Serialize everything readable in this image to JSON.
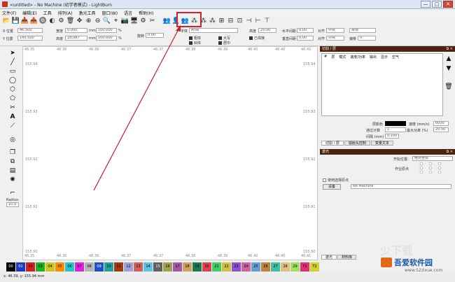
{
  "window": {
    "title": "<untitled> - No Machine (初学者模式) - LightBurn",
    "controls": [
      "—",
      "□",
      "✕"
    ]
  },
  "menu": [
    "文件(F)",
    "编辑(E)",
    "工具",
    "排列(A)",
    "激光工具",
    "窗口(W)",
    "语言",
    "帮助(H)"
  ],
  "toolbar": {
    "icons": [
      "📂",
      "💾",
      "📥",
      "📤",
      "🔘",
      "◐",
      "⚙",
      "🗑",
      "✥",
      "⊕",
      "⊖",
      "🔍",
      "⌖",
      "📷",
      "🖥",
      "⚙",
      "✂",
      "👥",
      "👤",
      "👥",
      "⁂",
      "⁂",
      "⁂",
      "⊞",
      "⊟",
      "⊡",
      "⊣",
      "⊢",
      "⊤"
    ]
  },
  "props": {
    "x_label": "X 位置",
    "x_value": "46.500",
    "y_label": "Y 位置",
    "y_value": "145.500",
    "w_label": "宽度",
    "w_value": "0.000",
    "h_label": "高度",
    "h_value": "18.087",
    "sx_value": "100.000",
    "sy_value": "100.000",
    "unit": "mm",
    "pct": "%",
    "rot_label": "旋转",
    "rot_value": "0.00",
    "font_label": "字体",
    "font_value": "Arial",
    "height_label": "高度",
    "height_value": "25.00",
    "hspace_label": "水平间距",
    "hspace_value": "0.00",
    "vspace_label": "垂直间距",
    "vspace_value": "0.00",
    "align_x_label": "对齐 X",
    "align_x_value": "中央",
    "align_y_label": "对齐 Y",
    "align_y_value": "中央",
    "normal_label": "常规",
    "offset_label": "偏移",
    "offset_value": "0",
    "bold": "粗体",
    "italic": "斜体",
    "caps": "大写",
    "welded": "已焊接",
    "weld_center": "居中"
  },
  "ruler_top": [
    "46.35",
    "46.36",
    "46.36",
    "46.37",
    "46.37",
    "46.38",
    "46.39",
    "46.40",
    "46.40",
    "46.41"
  ],
  "ruler_bottom": [
    "46.35",
    "46.36",
    "46.36",
    "46.37",
    "46.37",
    "46.38",
    "46.39",
    "46.40",
    "46.40",
    "46.41"
  ],
  "y_labels": [
    "155.94",
    "155.93",
    "155.92",
    "155.91",
    "155.90"
  ],
  "left_tools": {
    "radius_label": "Radius:",
    "radius_value": "10.0"
  },
  "status": {
    "coords": "x: 46.39, y: 155.94 mm"
  },
  "palette": [
    {
      "label": "00",
      "color": "#000000",
      "text": "#ffffff"
    },
    {
      "label": "01",
      "color": "#1e37c8",
      "text": "#ffffff"
    },
    {
      "label": "02",
      "color": "#d22020",
      "text": "#000000"
    },
    {
      "label": "03",
      "color": "#20b020",
      "text": "#000000"
    },
    {
      "label": "04",
      "color": "#c8c820",
      "text": "#000000"
    },
    {
      "label": "05",
      "color": "#ff8c00",
      "text": "#000000"
    },
    {
      "label": "06",
      "color": "#20c8c8",
      "text": "#000000"
    },
    {
      "label": "07",
      "color": "#e020e0",
      "text": "#000000"
    },
    {
      "label": "08",
      "color": "#b4b4b4",
      "text": "#000000"
    },
    {
      "label": "09",
      "color": "#2050c8",
      "text": "#ffffff"
    },
    {
      "label": "10",
      "color": "#20a0a0",
      "text": "#000000"
    },
    {
      "label": "11",
      "color": "#a03c14",
      "text": "#000000"
    },
    {
      "label": "12",
      "color": "#a0a0d8",
      "text": "#000000"
    },
    {
      "label": "13",
      "color": "#d06060",
      "text": "#000000"
    },
    {
      "label": "14",
      "color": "#60c0e0",
      "text": "#000000"
    },
    {
      "label": "15",
      "color": "#606060",
      "text": "#ffffff"
    },
    {
      "label": "16",
      "color": "#a0a050",
      "text": "#000000"
    },
    {
      "label": "17",
      "color": "#a05aa0",
      "text": "#000000"
    },
    {
      "label": "18",
      "color": "#d0a060",
      "text": "#000000"
    },
    {
      "label": "19",
      "color": "#207850",
      "text": "#000000"
    },
    {
      "label": "20",
      "color": "#e04050",
      "text": "#000000"
    },
    {
      "label": "21",
      "color": "#40d060",
      "text": "#000000"
    },
    {
      "label": "22",
      "color": "#d0c040",
      "text": "#000000"
    },
    {
      "label": "23",
      "color": "#9050d0",
      "text": "#000000"
    },
    {
      "label": "24",
      "color": "#d060a0",
      "text": "#000000"
    },
    {
      "label": "25",
      "color": "#60a0d0",
      "text": "#000000"
    },
    {
      "label": "26",
      "color": "#c08040",
      "text": "#000000"
    },
    {
      "label": "27",
      "color": "#40c0a0",
      "text": "#000000"
    },
    {
      "label": "28",
      "color": "#e0c080",
      "text": "#000000"
    },
    {
      "label": "29",
      "color": "#a0e060",
      "text": "#000000"
    },
    {
      "label": "T1",
      "color": "#e03070",
      "text": "#000000"
    },
    {
      "label": "T2",
      "color": "#d0d030",
      "text": "#000000"
    }
  ],
  "right": {
    "cuts_title": "切割 / 层",
    "cuts_cols": [
      "#",
      "层",
      "模式",
      "速度/功率",
      "输出",
      "显示",
      "空气"
    ],
    "layer_color_label": "层颜色",
    "speed_label": "速度 (mm/s)",
    "speed_value": "6000",
    "passes_label": "通过计数",
    "passes_value": "1",
    "maxpower_label": "最大功率 (%)",
    "maxpower_value": "20.00",
    "interval_label": "间隔 (mm)",
    "interval_value": "0.100",
    "tabs1": [
      "切割 / 层",
      "镭射头控制",
      "变量文本"
    ],
    "laser_title": "激光",
    "start_label": "开始位置:",
    "start_value": "绝对坐标",
    "origin_label": "作业原点",
    "use_selection": "使用选择原点",
    "devices_btn": "设备",
    "device_value": "No Machine",
    "tabs2": [
      "激光",
      "材料库"
    ]
  }
}
